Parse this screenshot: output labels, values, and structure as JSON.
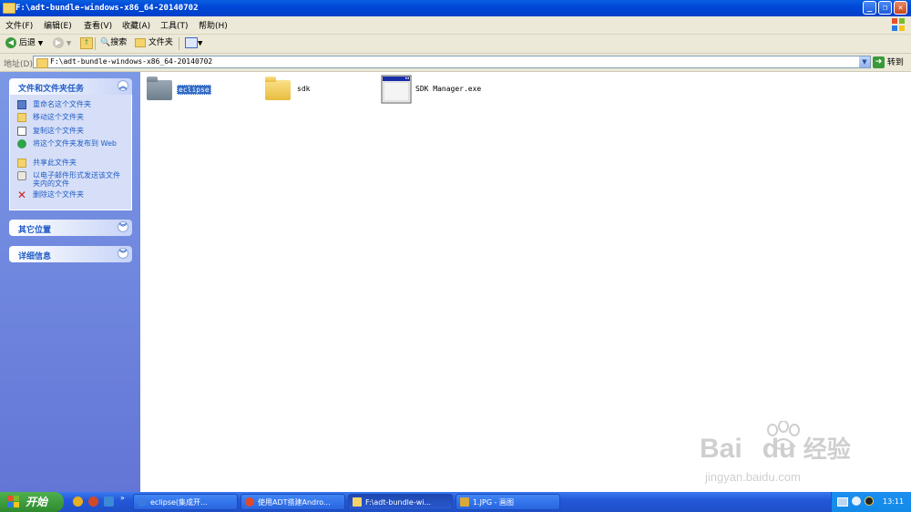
{
  "window": {
    "title": "F:\\adt-bundle-windows-x86_64-20140702",
    "minimize": "_",
    "restore": "❐",
    "close": "✕"
  },
  "menu": [
    "文件(F)",
    "编辑(E)",
    "查看(V)",
    "收藏(A)",
    "工具(T)",
    "帮助(H)"
  ],
  "toolbar": {
    "back": "后退",
    "search": "搜索",
    "folders": "文件夹"
  },
  "address": {
    "label": "地址(D)",
    "value": "F:\\adt-bundle-windows-x86_64-20140702",
    "go": "转到"
  },
  "tasks_panel": {
    "title": "文件和文件夹任务",
    "items": [
      {
        "label": "重命名这个文件夹",
        "icon": "rename-icon"
      },
      {
        "label": "移动这个文件夹",
        "icon": "move-icon"
      },
      {
        "label": "复制这个文件夹",
        "icon": "copy-icon"
      },
      {
        "label": "将这个文件夹发布到 Web",
        "icon": "publish-web-icon"
      },
      {
        "label": "共享此文件夹",
        "icon": "share-icon"
      },
      {
        "label": "以电子邮件形式发送该文件夹内的文件",
        "icon": "email-icon"
      },
      {
        "label": "删除这个文件夹",
        "icon": "delete-icon"
      }
    ]
  },
  "other_places": {
    "title": "其它位置"
  },
  "details": {
    "title": "详细信息"
  },
  "files": [
    {
      "name": "eclipse",
      "type": "folder",
      "selected": true
    },
    {
      "name": "sdk",
      "type": "folder",
      "selected": false
    },
    {
      "name": "SDK Manager.exe",
      "type": "exe",
      "selected": false
    }
  ],
  "watermark": {
    "brand": "Bai",
    "brand2": "du",
    "cn": "经验",
    "url": "jingyan.baidu.com"
  },
  "taskbar": {
    "start": "开始",
    "buttons": [
      "eclipse(集成开...",
      "使用ADT搭建Andro...",
      "F:\\adt-bundle-wi...",
      "1.JPG - 画图"
    ],
    "clock": "13:11"
  },
  "colors": {
    "accent": "#0048d8",
    "taskpane": "#6f86dd",
    "selection": "#316ac5"
  }
}
